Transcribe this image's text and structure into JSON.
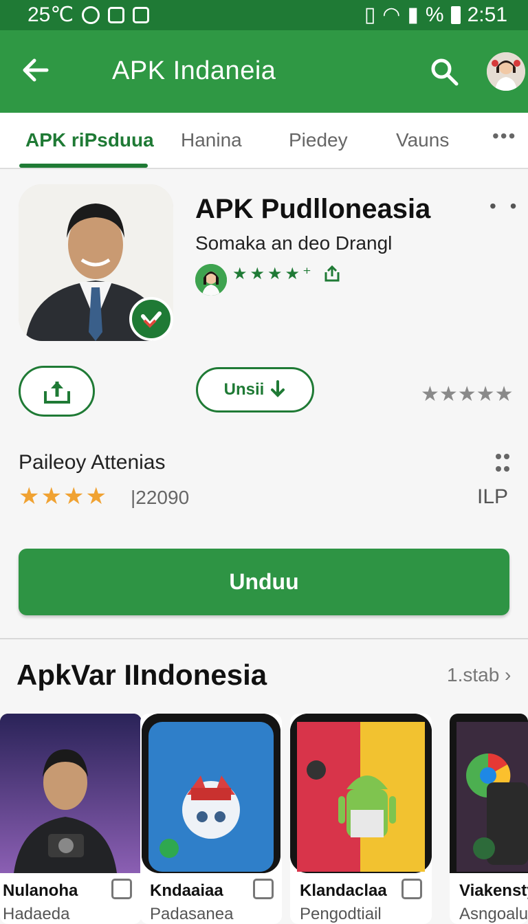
{
  "status_bar": {
    "left_text": "25℃",
    "time": "2:51",
    "battery_label": "%"
  },
  "app_bar": {
    "title": "APK Indaneia"
  },
  "tabs": [
    {
      "label": "APK riPsduua"
    },
    {
      "label": "Hanina"
    },
    {
      "label": "Piedey"
    },
    {
      "label": "Vauns"
    }
  ],
  "tab_more": "•••",
  "app": {
    "title": "APK Pudlloneasia",
    "subtitle": "Somaka an deo Drangl",
    "mini_rating": "★★★★⁺",
    "more": "• •"
  },
  "actions": {
    "install_label": "Unsii",
    "gray_stars": "★★★★★"
  },
  "rating": {
    "title": "Paileoy Attenias",
    "stars": "★★★★",
    "count": "|22090",
    "label": "ILP"
  },
  "download_label": "Unduu",
  "section": {
    "title": "ApkVar IIndonesia",
    "link": "1.stab ›"
  },
  "cards": [
    {
      "name": "Nulanoha",
      "publisher": "Hadaeda"
    },
    {
      "name": "Kndaaiaa",
      "publisher": "Padasanea"
    },
    {
      "name": "Klandaclaa",
      "publisher": "Pengodtiail"
    },
    {
      "name": "Viakensty",
      "publisher": "Asngoalua"
    }
  ],
  "colors": {
    "primary": "#2f9844",
    "dark_primary": "#1f7a35",
    "star": "#f0a232"
  }
}
